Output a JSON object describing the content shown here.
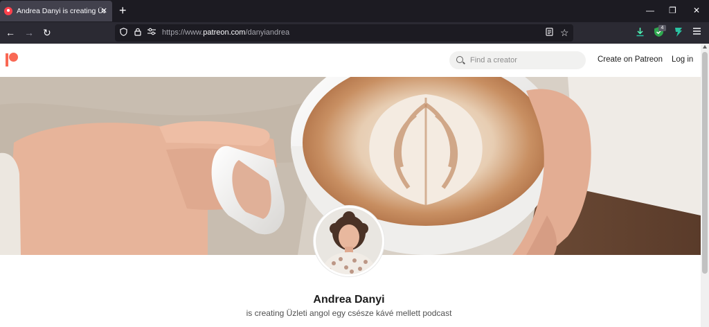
{
  "browser": {
    "tab_title": "Andrea Danyi is creating Üzleti a",
    "url_prefix": "https://www.",
    "url_domain": "patreon.com",
    "url_path": "/danyiandrea",
    "extension_badge": "4",
    "icons": {
      "back": "arrow-left",
      "forward": "arrow-right",
      "reload": "reload",
      "shield": "shield",
      "lock": "lock",
      "permissions": "sliders",
      "reader": "reader-view",
      "bookmark": "star",
      "download": "download-arrow",
      "ext_shield": "green-shield",
      "ext_green": "green-leaf",
      "menu": "hamburger"
    }
  },
  "header": {
    "search_placeholder": "Find a creator",
    "create_link": "Create on Patreon",
    "login_link": "Log in",
    "brand_color": "#f96854"
  },
  "profile": {
    "name": "Andrea Danyi",
    "tagline": "is creating Üzleti angol egy csésze kávé mellett podcast"
  }
}
